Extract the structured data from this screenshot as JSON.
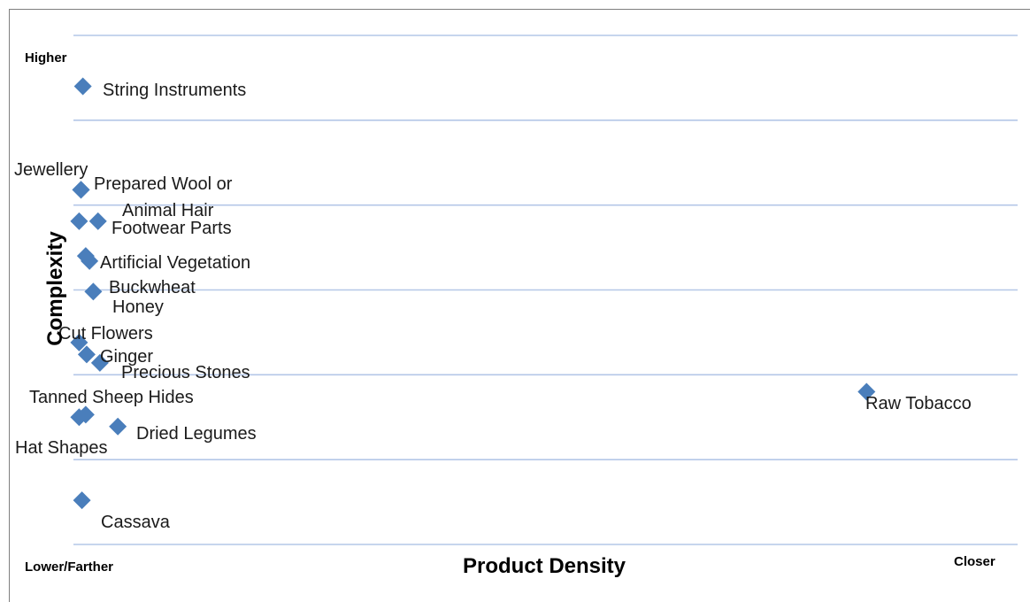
{
  "chart_data": {
    "type": "scatter",
    "title": "",
    "xlabel": "Product Density",
    "ylabel": "Complexity",
    "x_axis_low_label": "Lower/Farther",
    "x_axis_high_label": "Closer",
    "y_axis_high_label": "Higher",
    "xlim": [
      0,
      1
    ],
    "ylim": [
      0,
      6
    ],
    "grid": "horizontal",
    "legend": "none",
    "marker_color": "#4a7ebb",
    "gridline_color": "#b4c7e7",
    "points": [
      {
        "label": "String Instruments",
        "x": 0.01,
        "y": 5.4
      },
      {
        "label": "Jewellery",
        "x": 0.008,
        "y": 4.18
      },
      {
        "label": "Prepared Wool or Animal Hair",
        "x": 0.008,
        "y": 4.18
      },
      {
        "label": "Footwear Parts",
        "x": 0.026,
        "y": 3.81
      },
      {
        "label": "Footwear Parts (2)",
        "x": 0.006,
        "y": 3.81
      },
      {
        "label": "Artificial Vegetation",
        "x": 0.013,
        "y": 3.4
      },
      {
        "label": "Buckwheat",
        "x": 0.017,
        "y": 3.34
      },
      {
        "label": "Honey",
        "x": 0.021,
        "y": 2.98
      },
      {
        "label": "Cut Flowers",
        "x": 0.006,
        "y": 2.38
      },
      {
        "label": "Ginger",
        "x": 0.014,
        "y": 2.24
      },
      {
        "label": "Precious Stones",
        "x": 0.028,
        "y": 2.14
      },
      {
        "label": "Raw Tobacco",
        "x": 0.84,
        "y": 1.8
      },
      {
        "label": "Tanned Sheep Hides",
        "x": 0.013,
        "y": 1.53
      },
      {
        "label": "Hat Shapes",
        "x": 0.006,
        "y": 1.5
      },
      {
        "label": "Dried Legumes",
        "x": 0.047,
        "y": 1.39
      },
      {
        "label": "Cassava",
        "x": 0.009,
        "y": 0.52
      }
    ],
    "annotations": [
      {
        "text": "String Instruments"
      },
      {
        "text": "Jewellery"
      },
      {
        "text": "Prepared Wool or"
      },
      {
        "text": "Animal Hair"
      },
      {
        "text": "Footwear Parts"
      },
      {
        "text": "Artificial Vegetation"
      },
      {
        "text": "Buckwheat"
      },
      {
        "text": "Honey"
      },
      {
        "text": "Cut Flowers"
      },
      {
        "text": "Ginger"
      },
      {
        "text": "Precious Stones"
      },
      {
        "text": "Raw Tobacco"
      },
      {
        "text": "Tanned Sheep Hides"
      },
      {
        "text": "Hat Shapes"
      },
      {
        "text": "Dried Legumes"
      },
      {
        "text": "Cassava"
      }
    ]
  }
}
